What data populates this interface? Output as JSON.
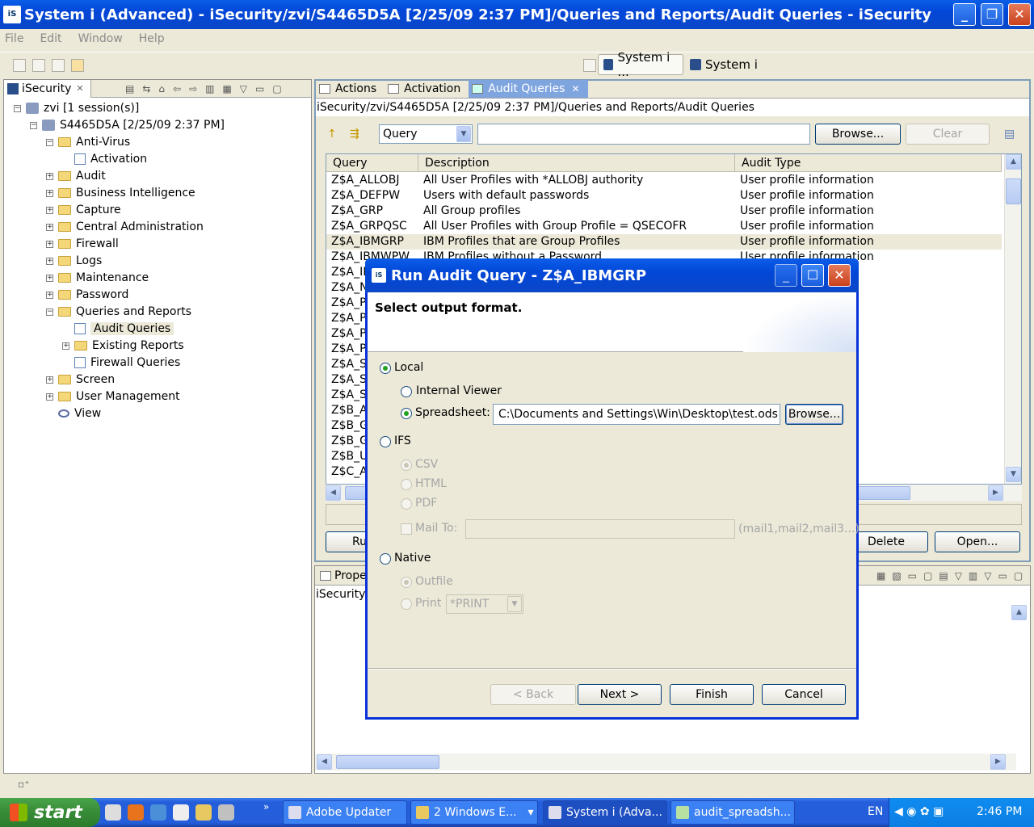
{
  "window": {
    "title": "System i (Advanced) - iSecurity/zvi/S4465D5A [2/25/09 2:37 PM]/Queries and Reports/Audit Queries - iSecurity",
    "app_icon": "iS"
  },
  "menu": [
    "File",
    "Edit",
    "Window",
    "Help"
  ],
  "perspectives": [
    "System i ...",
    "System i"
  ],
  "left_panel": {
    "tab_label": "iSecurity",
    "tree": [
      {
        "label": "zvi [1 session(s)]",
        "level": 0,
        "icon": "network-icon",
        "toggle": "-"
      },
      {
        "label": "S4465D5A [2/25/09 2:37 PM]",
        "level": 1,
        "icon": "server-icon",
        "toggle": "-"
      },
      {
        "label": "Anti-Virus",
        "level": 2,
        "icon": "folder-icon",
        "toggle": "-"
      },
      {
        "label": "Activation",
        "level": 3,
        "icon": "document-icon",
        "toggle": ""
      },
      {
        "label": "Audit",
        "level": 2,
        "icon": "folder-icon",
        "toggle": "+"
      },
      {
        "label": "Business Intelligence",
        "level": 2,
        "icon": "folder-icon",
        "toggle": "+"
      },
      {
        "label": "Capture",
        "level": 2,
        "icon": "folder-icon",
        "toggle": "+"
      },
      {
        "label": "Central Administration",
        "level": 2,
        "icon": "folder-icon",
        "toggle": "+"
      },
      {
        "label": "Firewall",
        "level": 2,
        "icon": "folder-icon",
        "toggle": "+"
      },
      {
        "label": "Logs",
        "level": 2,
        "icon": "folder-icon",
        "toggle": "+"
      },
      {
        "label": "Maintenance",
        "level": 2,
        "icon": "folder-icon",
        "toggle": "+"
      },
      {
        "label": "Password",
        "level": 2,
        "icon": "folder-icon",
        "toggle": "+"
      },
      {
        "label": "Queries and Reports",
        "level": 2,
        "icon": "folder-icon",
        "toggle": "-"
      },
      {
        "label": "Audit Queries",
        "level": 3,
        "icon": "document-icon",
        "toggle": "",
        "selected": true
      },
      {
        "label": "Existing Reports",
        "level": 3,
        "icon": "folder-icon",
        "toggle": "+"
      },
      {
        "label": "Firewall Queries",
        "level": 3,
        "icon": "document-icon",
        "toggle": ""
      },
      {
        "label": "Screen",
        "level": 2,
        "icon": "folder-icon",
        "toggle": "+"
      },
      {
        "label": "User Management",
        "level": 2,
        "icon": "folder-icon",
        "toggle": "+"
      },
      {
        "label": "View",
        "level": 2,
        "icon": "eye-icon",
        "toggle": ""
      }
    ]
  },
  "editor": {
    "tabs": [
      "Actions",
      "Activation",
      "Audit Queries"
    ],
    "path": "iSecurity/zvi/S4465D5A [2/25/09 2:37 PM]/Queries and Reports/Audit Queries",
    "filter_combo": "Query",
    "filter_text": "",
    "browse_label": "Browse...",
    "clear_label": "Clear",
    "columns": [
      "Query",
      "Description",
      "Audit Type"
    ],
    "rows": [
      {
        "query": "Z$A_ALLOBJ",
        "description": "All User Profiles with *ALLOBJ authority",
        "type": "User profile information"
      },
      {
        "query": "Z$A_DEFPW",
        "description": "Users with default passwords",
        "type": "User profile information"
      },
      {
        "query": "Z$A_GRP",
        "description": "All Group profiles",
        "type": "User profile information"
      },
      {
        "query": "Z$A_GRPQSC",
        "description": "All User Profiles with Group Profile = QSECOFR",
        "type": "User profile information"
      },
      {
        "query": "Z$A_IBMGRP",
        "description": "IBM Profiles that are Group Profiles",
        "type": "User profile information",
        "selected": true
      },
      {
        "query": "Z$A_IBMWPW",
        "description": "IBM Profiles without a Password",
        "type": "User profile information"
      },
      {
        "query": "Z$A_IN",
        "description": "",
        "type": ""
      },
      {
        "query": "Z$A_N",
        "description": "",
        "type": ""
      },
      {
        "query": "Z$A_P",
        "description": "",
        "type": ""
      },
      {
        "query": "Z$A_P",
        "description": "",
        "type": ""
      },
      {
        "query": "Z$A_P",
        "description": "",
        "type": ""
      },
      {
        "query": "Z$A_P",
        "description": "",
        "type": ""
      },
      {
        "query": "Z$A_S",
        "description": "",
        "type": ""
      },
      {
        "query": "Z$A_S",
        "description": "",
        "type": ""
      },
      {
        "query": "Z$A_S",
        "description": "",
        "type": ""
      },
      {
        "query": "Z$B_A",
        "description": "",
        "type": "d by a user"
      },
      {
        "query": "Z$B_G",
        "description": "",
        "type": "d by a user"
      },
      {
        "query": "Z$B_G",
        "description": "",
        "type": "d by a user"
      },
      {
        "query": "Z$B_U",
        "description": "",
        "type": "d by a user"
      },
      {
        "query": "Z$C_A",
        "description": "",
        "type": "heir primary group"
      }
    ],
    "bottom_buttons": {
      "run": "Ru",
      "delete": "Delete",
      "open": "Open..."
    }
  },
  "properties": {
    "tab_label": "Prope",
    "content": "iSecurity c"
  },
  "dialog": {
    "title": "Run Audit Query - Z$A_IBMGRP",
    "heading": "Select output format.",
    "local_label": "Local",
    "internal_viewer_label": "Internal Viewer",
    "spreadsheet_label": "Spreadsheet:",
    "spreadsheet_path": "C:\\Documents and Settings\\Win\\Desktop\\test.ods",
    "browse_label": "Browse...",
    "ifs_label": "IFS",
    "csv_label": "CSV",
    "html_label": "HTML",
    "pdf_label": "PDF",
    "mailto_label": "Mail To:",
    "mailto_value": "",
    "mailto_hint": "(mail1,mail2,mail3...)",
    "native_label": "Native",
    "outfile_label": "Outfile",
    "print_label": "Print",
    "print_value": "*PRINT",
    "back_label": "< Back",
    "next_label": "Next >",
    "finish_label": "Finish",
    "cancel_label": "Cancel"
  },
  "taskbar": {
    "start_label": "start",
    "tasks": [
      "Adobe Updater",
      "2 Windows E...",
      "System i (Adva...",
      "audit_spreadsh..."
    ],
    "lang": "EN",
    "clock": "2:46 PM"
  }
}
